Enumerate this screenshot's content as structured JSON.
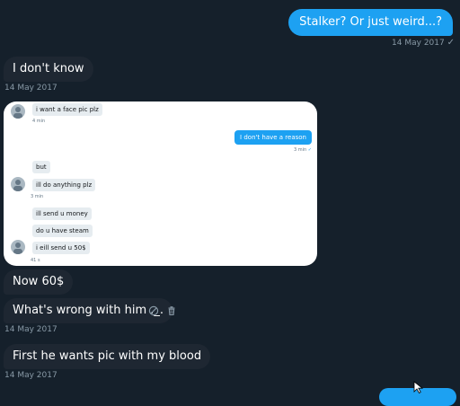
{
  "messages": {
    "m1": {
      "text": "Stalker? Or just weird...?",
      "time": "14 May 2017",
      "status": "✓"
    },
    "m2": {
      "text": "I don't know",
      "time": "14 May 2017"
    },
    "m3": {
      "text": "Now 60$"
    },
    "m4": {
      "text": "What's wrong with him ._.",
      "time": "14 May 2017"
    },
    "m5": {
      "text": "First he wants pic with my blood",
      "time": "14 May 2017"
    }
  },
  "screenshot": {
    "i1": "i want a face pic plz",
    "i1_time": "4 min",
    "o1": "I don't have a reason",
    "o1_time": "3 min",
    "o1_status": "✓",
    "i2": "but",
    "i3": "ill do anything plz",
    "i3_time": "3 min",
    "i4": "ill send u money",
    "i5": "do u have steam",
    "i6": "i eill send u 50$",
    "i6_time": "41 s"
  },
  "icons": {
    "remove": "ban-icon",
    "delete": "trash-icon"
  }
}
